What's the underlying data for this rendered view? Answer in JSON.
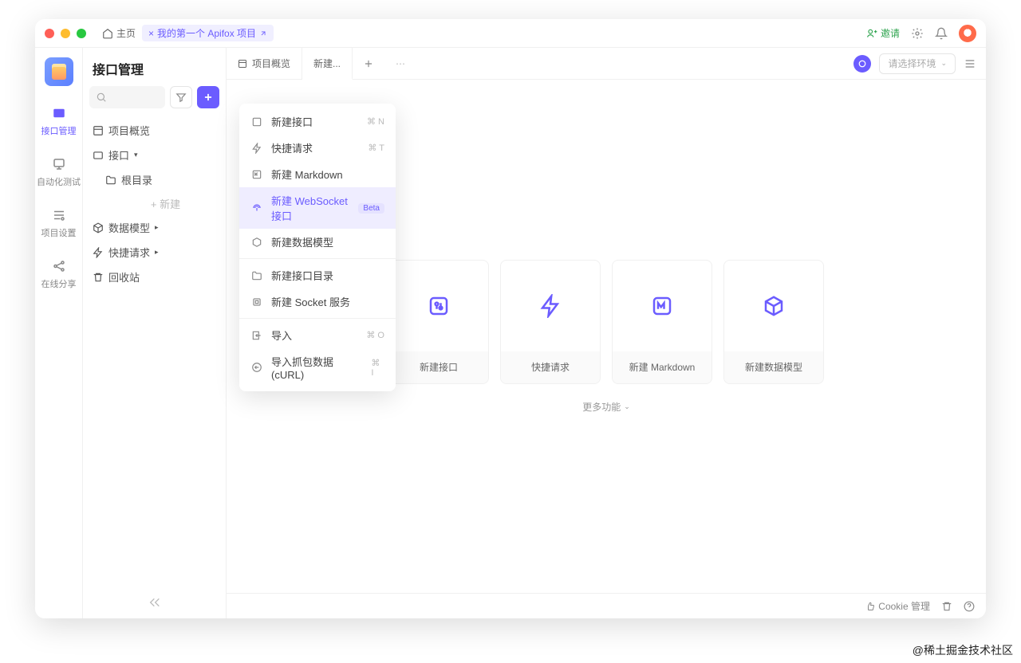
{
  "titlebar": {
    "home": "主页",
    "project_tab": "我的第一个 Apifox 项目",
    "invite": "邀请"
  },
  "rail": {
    "items": [
      {
        "label": "接口管理",
        "active": true
      },
      {
        "label": "自动化测试",
        "active": false
      },
      {
        "label": "项目设置",
        "active": false
      },
      {
        "label": "在线分享",
        "active": false
      }
    ]
  },
  "sidebar": {
    "title": "接口管理",
    "tree": {
      "overview": "项目概览",
      "api": "接口",
      "root_dir": "根目录",
      "new_hint": "+ 新建",
      "data_model": "数据模型",
      "quick_req": "快捷请求",
      "trash": "回收站"
    },
    "brand": "Apifox"
  },
  "tabs": {
    "overview": "项目概览",
    "new": "新建...",
    "env_placeholder": "请选择环境"
  },
  "dropdown": {
    "items": [
      {
        "label": "新建接口",
        "shortcut": "⌘ N",
        "icon": "api"
      },
      {
        "label": "快捷请求",
        "shortcut": "⌘ T",
        "icon": "bolt"
      },
      {
        "label": "新建 Markdown",
        "icon": "md"
      },
      {
        "label": "新建 WebSocket 接口",
        "badge": "Beta",
        "icon": "ws",
        "highlight": true
      },
      {
        "label": "新建数据模型",
        "icon": "cube"
      }
    ],
    "group2": [
      {
        "label": "新建接口目录",
        "icon": "folder"
      },
      {
        "label": "新建 Socket 服务",
        "icon": "socket"
      }
    ],
    "group3": [
      {
        "label": "导入",
        "shortcut": "⌘ O",
        "icon": "import"
      },
      {
        "label": "导入抓包数据(cURL)",
        "shortcut": "⌘ I",
        "icon": "curl"
      }
    ]
  },
  "cards": [
    {
      "label": "新建接口",
      "icon": "api"
    },
    {
      "label": "快捷请求",
      "icon": "bolt"
    },
    {
      "label": "新建 Markdown",
      "icon": "md"
    },
    {
      "label": "新建数据模型",
      "icon": "cube"
    }
  ],
  "more_functions": "更多功能",
  "footer": {
    "cookie": "Cookie 管理"
  },
  "watermark": "@稀土掘金技术社区"
}
